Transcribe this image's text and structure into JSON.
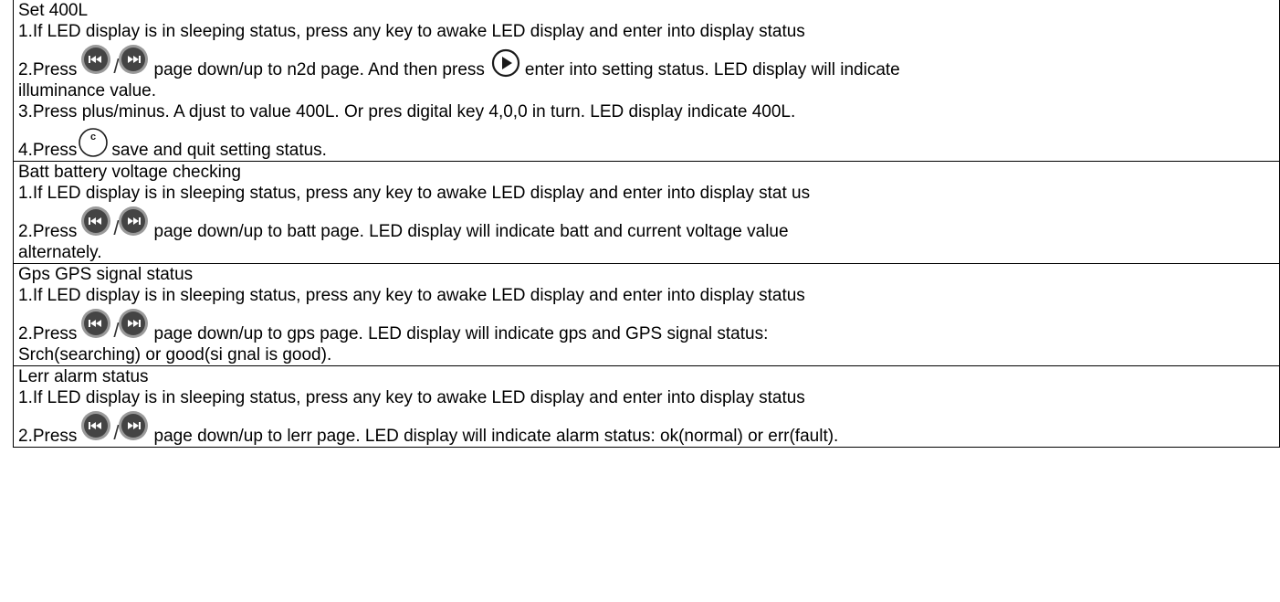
{
  "sections": [
    {
      "title": "Set 400L",
      "step1": "1.If LED display is in sleeping status, press any key to awake LED display and enter into display status",
      "step2_prefix": "2.Press",
      "step2_mid": "page down/up to n2d page. And then press",
      "step2_suffix": "enter into setting status. LED display will indicate",
      "step2_cont": "illuminance value.",
      "step3": "3.Press plus/minus. A djust to value 400L. Or pres digital key 4,0,0 in turn. LED display indicate 400L.",
      "step4_prefix": "4.Press",
      "step4_suffix": "save and quit setting status."
    },
    {
      "title": "Batt battery voltage checking",
      "step1": "1.If LED display is in sleeping status, press any key to awake LED display and enter into display stat us",
      "step2_prefix": "2.Press",
      "step2_suffix": "page down/up to batt page. LED display will indicate batt and current voltage value",
      "step2_cont": "alternately."
    },
    {
      "title": "Gps GPS signal status",
      "step1": "1.If LED display is in sleeping status, press any key to awake LED display and enter into display status",
      "step2_prefix": "2.Press",
      "step2_suffix": "page down/up to gps page. LED display will indicate gps and GPS signal status:",
      "step2_cont": "Srch(searching) or good(si gnal is good)."
    },
    {
      "title": "Lerr alarm status",
      "step1": "1.If LED display is in sleeping status, press any key to awake LED display and enter into display status",
      "step2_prefix": "2.Press",
      "step2_suffix": "page down/up to lerr page. LED display will indicate alarm status: ok(normal) or err(fault)."
    }
  ],
  "icons": {
    "prev": "previous-track-icon",
    "next": "next-track-icon",
    "play": "play-icon",
    "clear": "c-key-icon",
    "separator": "/"
  },
  "colors": {
    "button_face": "#444444",
    "button_rim": "#9a9a9a",
    "outline": "#1a1a1a"
  }
}
